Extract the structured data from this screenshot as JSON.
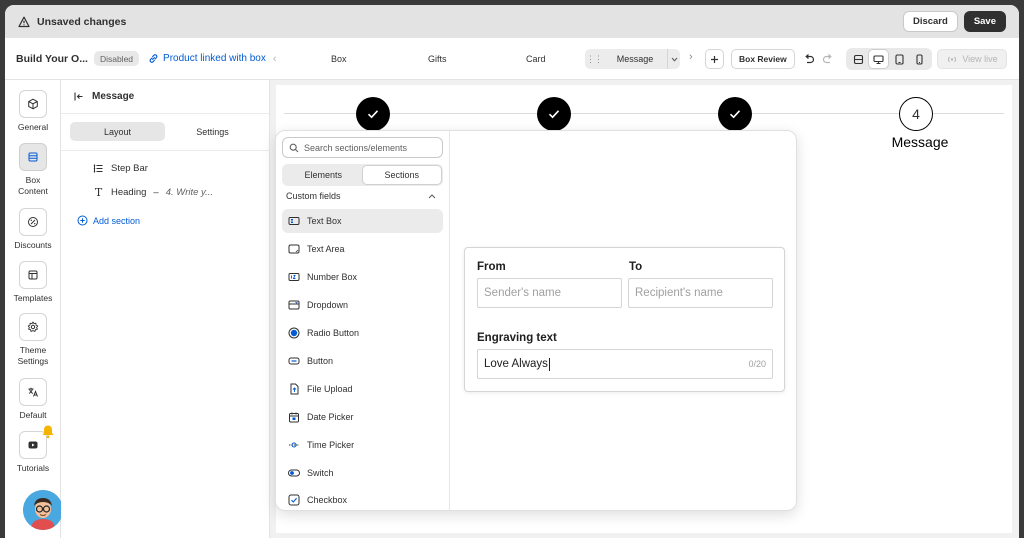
{
  "topbar": {
    "status": "Unsaved changes",
    "discard_label": "Discard",
    "save_label": "Save"
  },
  "header": {
    "title": "Build Your O...",
    "badge": "Disabled",
    "linked_label": "Product linked with box",
    "step_tabs": [
      "Box",
      "Gifts",
      "Card"
    ],
    "current_step": "Message",
    "box_review_label": "Box Review",
    "view_live_label": "View live"
  },
  "rail": {
    "items": [
      {
        "label": "General",
        "icon": "cube-icon"
      },
      {
        "label": "Box Content",
        "icon": "layers-icon"
      },
      {
        "label": "Discounts",
        "icon": "discount-icon"
      },
      {
        "label": "Templates",
        "icon": "template-icon"
      },
      {
        "label": "Theme Settings",
        "icon": "gear-icon"
      },
      {
        "label": "Default",
        "icon": "language-icon"
      },
      {
        "label": "Tutorials",
        "icon": "play-icon"
      }
    ]
  },
  "sections_panel": {
    "title": "Message",
    "tabs": [
      "Layout",
      "Settings"
    ],
    "active_tab": "Layout",
    "rows": [
      {
        "label": "Step Bar",
        "sub": ""
      },
      {
        "label": "Heading",
        "sub": "4. Write y..."
      }
    ],
    "add_section_label": "Add section"
  },
  "stepbar": {
    "steps": [
      {
        "state": "done"
      },
      {
        "state": "done"
      },
      {
        "state": "done"
      },
      {
        "state": "current",
        "number": "4",
        "label": "Message"
      }
    ]
  },
  "popover": {
    "search_placeholder": "Search sections/elements",
    "tabs": [
      "Elements",
      "Sections"
    ],
    "active_tab": "Sections",
    "group_label": "Custom fields",
    "elements": [
      {
        "label": "Text Box",
        "icon": "text-box-icon"
      },
      {
        "label": "Text Area",
        "icon": "text-area-icon"
      },
      {
        "label": "Number Box",
        "icon": "number-box-icon"
      },
      {
        "label": "Dropdown",
        "icon": "dropdown-icon"
      },
      {
        "label": "Radio Button",
        "icon": "radio-icon"
      },
      {
        "label": "Button",
        "icon": "button-icon"
      },
      {
        "label": "File Upload",
        "icon": "file-upload-icon"
      },
      {
        "label": "Date Picker",
        "icon": "calendar-icon"
      },
      {
        "label": "Time Picker",
        "icon": "time-icon"
      },
      {
        "label": "Switch",
        "icon": "switch-icon"
      },
      {
        "label": "Checkbox",
        "icon": "checkbox-icon"
      }
    ]
  },
  "form": {
    "from_label": "From",
    "from_placeholder": "Sender's name",
    "to_label": "To",
    "to_placeholder": "Recipient's name",
    "engraving_label": "Engraving text",
    "engraving_value": "Love Always",
    "engraving_counter": "0/20"
  },
  "colors": {
    "accent_link": "#005bd3",
    "dark": "#303030",
    "step_done": "#000000"
  }
}
